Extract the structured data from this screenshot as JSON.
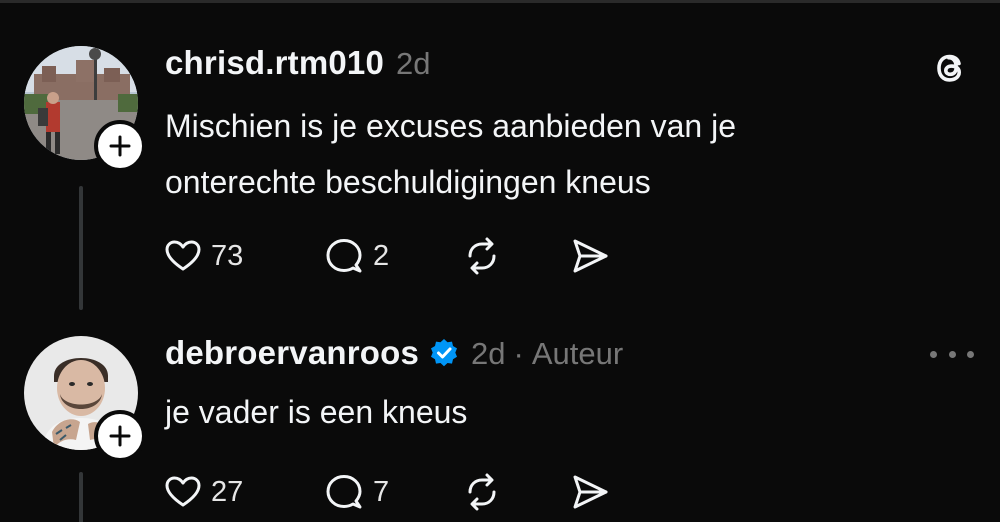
{
  "posts": [
    {
      "username": "chrisd.rtm010",
      "age": "2d",
      "text_lines": [
        "Mischien is je excuses aanbieden van je",
        "onterechte beschuldigingen kneus"
      ],
      "likes": "73",
      "replies": "2",
      "avatar_icon": "avatar-photo-street",
      "top_right_icon": "threads-logo-icon"
    },
    {
      "username": "debroervanroos",
      "verified": true,
      "age": "2d",
      "separator": "·",
      "role": "Auteur",
      "text_lines": [
        "je vader is een kneus"
      ],
      "likes": "27",
      "replies": "7",
      "avatar_icon": "avatar-photo-portrait",
      "top_right_icon": "more-options-icon"
    }
  ],
  "colors": {
    "background": "#0a0a0a",
    "text": "#f3f5f7",
    "muted": "#777777",
    "verified": "#0095f6"
  }
}
